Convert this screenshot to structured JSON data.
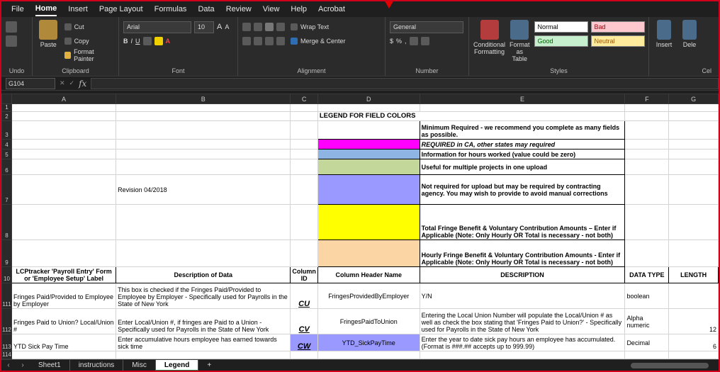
{
  "menu": [
    "File",
    "Home",
    "Insert",
    "Page Layout",
    "Formulas",
    "Data",
    "Review",
    "View",
    "Help",
    "Acrobat"
  ],
  "active_menu": "Home",
  "ribbon": {
    "undo_label": "Undo",
    "clipboard": {
      "paste": "Paste",
      "cut": "Cut",
      "copy": "Copy",
      "format_painter": "Format Painter",
      "label": "Clipboard"
    },
    "font": {
      "name": "Arial",
      "size": "10",
      "label": "Font"
    },
    "alignment": {
      "wrap_text": "Wrap Text",
      "merge_center": "Merge & Center",
      "label": "Alignment"
    },
    "number": {
      "format": "General",
      "label": "Number"
    },
    "styles": {
      "conditional": "Conditional Formatting",
      "format_as_table": "Format as Table",
      "normal": "Normal",
      "bad": "Bad",
      "good": "Good",
      "neutral": "Neutral",
      "label": "Styles"
    },
    "cells": {
      "insert": "Insert",
      "delete": "Dele",
      "label": "Cel"
    }
  },
  "formula_bar": {
    "cell_ref": "G104",
    "fx": "fx"
  },
  "columns": [
    "A",
    "B",
    "C",
    "D",
    "E",
    "F",
    "G"
  ],
  "legend": {
    "title": "LEGEND FOR FIELD COLORS",
    "revision": "Revision 04/2018",
    "items": [
      {
        "color": "#ffffff",
        "text": "Minimum Required - we recommend you complete as many fields as possible.",
        "style": "bold"
      },
      {
        "color": "#ff00ff",
        "text": "REQUIRED in CA, other states may required",
        "style": "bold-italic"
      },
      {
        "color": "#8db4e2",
        "text": "Information for hours worked (value could be zero)",
        "style": "bold"
      },
      {
        "color": "#c4d79b",
        "text": "Useful for multiple projects in one upload",
        "style": "bold"
      },
      {
        "color": "#9999ff",
        "text": "Not required for upload but may be required by contracting agency. You may wish to provide to avoid manual corrections",
        "style": "bold"
      },
      {
        "color": "#ffff00",
        "text": "Total Fringe Benefit & Voluntary Contribution Amounts – Enter if Applicable (Note: Only Hourly OR Total is necessary - not both)",
        "style": "bold"
      },
      {
        "color": "#fcd5a4",
        "text": "Hourly Fringe Benefit & Voluntary Contribution Amounts - Enter if Applicable (Note: Only Hourly OR Total is necessary - not both)",
        "style": "bold"
      }
    ]
  },
  "table_header": {
    "a": "LCPtracker 'Payroll Entry' Form or 'Employee Setup' Label",
    "b": "Description of Data",
    "c": "Column ID",
    "d": "Column Header Name",
    "e": "DESCRIPTION",
    "f": "DATA TYPE",
    "g": "LENGTH"
  },
  "rows": [
    {
      "num": "111",
      "a": "Fringes Paid/Provided to Employee by Employer",
      "b": "This box is checked if the Fringes Paid/Provided to Employee by Employer - Specifically used for Payrolls in the State of New York",
      "c": "CU",
      "d": "FringesProvidedByEmployer",
      "e": "Y/N",
      "f": "boolean",
      "g": "",
      "highlight": ""
    },
    {
      "num": "112",
      "a": "Fringes Paid to Union? Local/Union #",
      "b": "Enter Local/Union #, if fringes are Paid to a Union - Specifically used for Payrolls in the State of New York",
      "c": "CV",
      "d": "FringesPaidToUnion",
      "e": "Entering the Local Union Number will populate the Local/Union # as well as check the box stating that 'Fringes Paid to Union?' - Specifically used for Payrolls in the State of New York",
      "f": "Alpha numeric",
      "g": "12",
      "highlight": ""
    },
    {
      "num": "113",
      "a": "YTD Sick Pay Time",
      "b": "Enter accumulative hours employee has earned towards sick time",
      "c": "CW",
      "d": "YTD_SickPayTime",
      "e": "Enter the year to date sick pay hours an employee has accumulated. (Format is ###.## accepts up to 999.99)",
      "f": "Decimal",
      "g": "6",
      "highlight": "#9999ff"
    }
  ],
  "row_numbers_top": [
    "1",
    "2",
    "3",
    "4",
    "5",
    "6",
    "7",
    "8",
    "9",
    "10"
  ],
  "row_114": "114",
  "tabs": [
    "Sheet1",
    "instructions",
    "Misc",
    "Legend"
  ],
  "active_tab": "Legend",
  "add_tab": "+"
}
